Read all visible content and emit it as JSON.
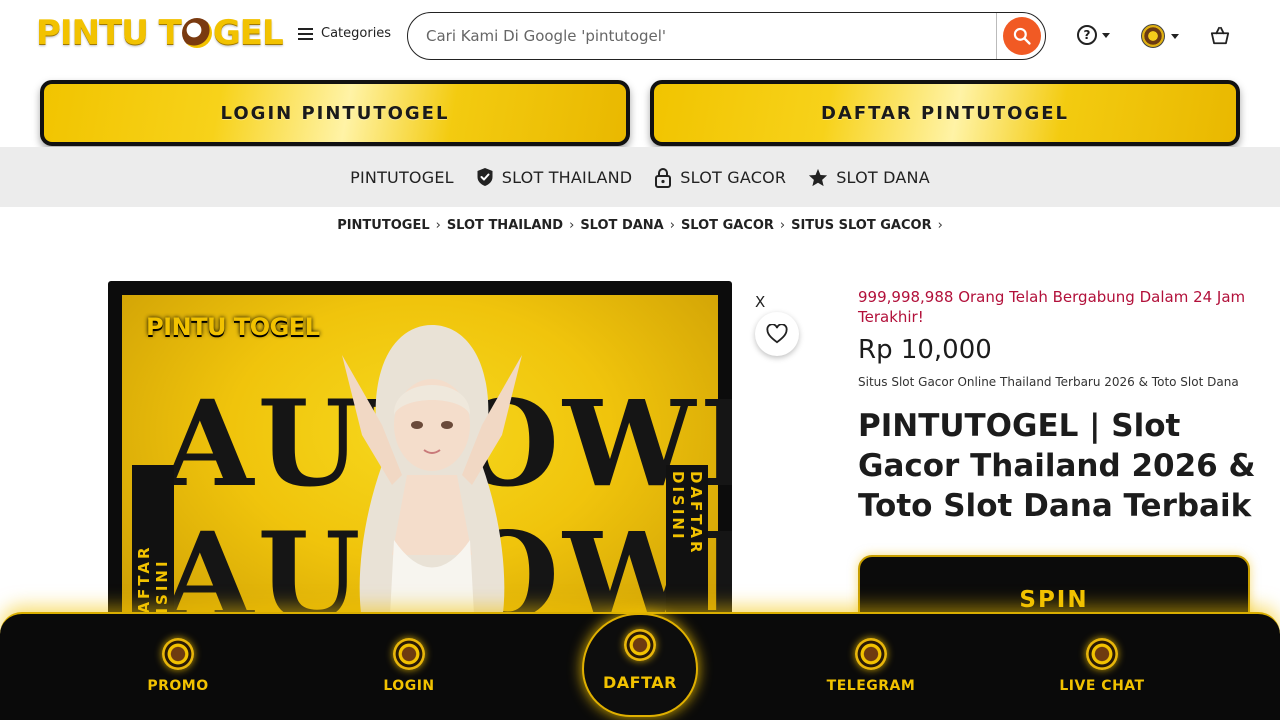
{
  "header": {
    "logo_text_1": "PINTU T",
    "logo_text_2": "GEL",
    "categories_label": "Categories",
    "search_placeholder": "Cari Kami Di Google 'pintutogel'"
  },
  "buttons": {
    "login": "LOGIN PINTUTOGEL",
    "daftar": "DAFTAR PINTUTOGEL"
  },
  "nav": [
    {
      "label": "PINTUTOGEL",
      "icon": "none"
    },
    {
      "label": "SLOT THAILAND",
      "icon": "shield-check-icon"
    },
    {
      "label": "SLOT GACOR",
      "icon": "lock-icon"
    },
    {
      "label": "SLOT DANA",
      "icon": "star-icon"
    }
  ],
  "breadcrumb": [
    "PINTUTOGEL",
    "SLOT THAILAND",
    "SLOT DANA",
    "SLOT GACOR",
    "SITUS SLOT GACOR"
  ],
  "product": {
    "image_logo": "PINTU TOGEL",
    "image_word_1": "AUTOWIN",
    "image_word_2": "AUTOWIN",
    "image_side_text": "DAFTAR DISINI",
    "close_label": "X",
    "joined_text": "999,998,988 Orang Telah Bergabung Dalam 24 Jam Terakhir!",
    "price": "Rp 10,000",
    "subtitle": "Situs Slot Gacor Online Thailand Terbaru 2026 & Toto Slot Dana",
    "title": "PINTUTOGEL | Slot Gacor Thailand 2026 & Toto Slot Dana Terbaik",
    "spin_label": "SPIN"
  },
  "bottom_nav": {
    "promo": "PROMO",
    "login": "LOGIN",
    "daftar": "DAFTAR",
    "telegram": "TELEGRAM",
    "livechat": "LIVE CHAT"
  },
  "colors": {
    "accent_yellow": "#f2c200",
    "search_button": "#f15a24",
    "joined_text": "#b2103a"
  }
}
